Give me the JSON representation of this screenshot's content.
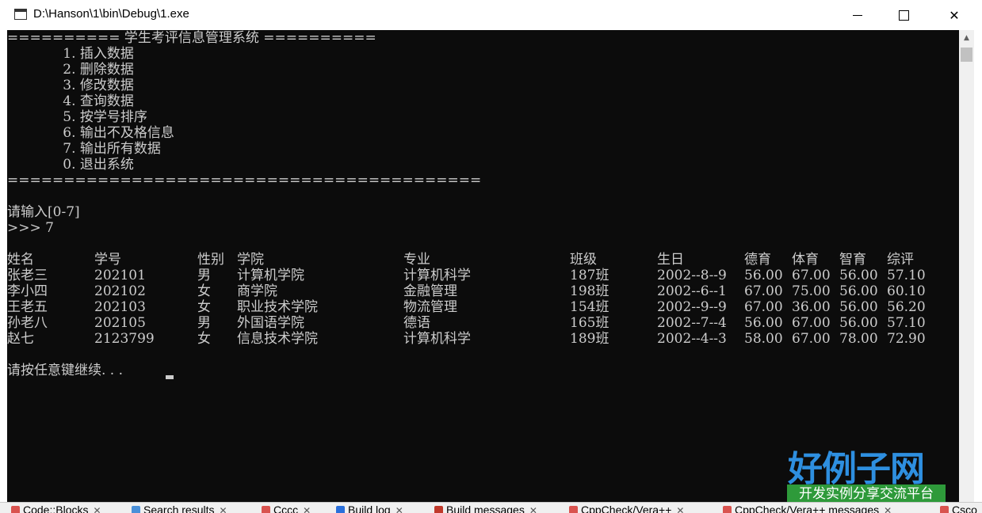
{
  "window": {
    "title": "D:\\Hanson\\1\\bin\\Debug\\1.exe",
    "minimize_label": "—",
    "maximize_label": "☐",
    "close_label": "✕"
  },
  "console": {
    "menu": [
      "========== 学生考评信息管理系统 ==========",
      "             1. 插入数据",
      "             2. 删除数据",
      "             3. 修改数据",
      "             4. 查询数据",
      "             5. 按学号排序",
      "             6. 输出不及格信息",
      "             7. 输出所有数据",
      "             0. 退出系统",
      "=========================================="
    ],
    "prompt": "请输入[0-7]",
    "input_line": ">>> 7",
    "table_headers": [
      "姓名",
      "学号",
      "性别",
      "学院",
      "专业",
      "班级",
      "生日",
      "德育",
      "体育",
      "智育",
      "综评"
    ],
    "table_rows": [
      [
        "张老三",
        "202101",
        "男",
        "计算机学院",
        "计算机科学",
        "187班",
        "2002--8--9",
        "56.00",
        "67.00",
        "56.00",
        "57.10"
      ],
      [
        "李小四",
        "202102",
        "女",
        "商学院",
        "金融管理",
        "198班",
        "2002--6--1",
        "67.00",
        "75.00",
        "56.00",
        "60.10"
      ],
      [
        "王老五",
        "202103",
        "女",
        "职业技术学院",
        "物流管理",
        "154班",
        "2002--9--9",
        "67.00",
        "36.00",
        "56.00",
        "56.20"
      ],
      [
        "孙老八",
        "202105",
        "男",
        "外国语学院",
        "德语",
        "165班",
        "2002--7--4",
        "56.00",
        "67.00",
        "56.00",
        "57.10"
      ],
      [
        "赵七",
        "2123799",
        "女",
        "信息技术学院",
        "计算机科学",
        "189班",
        "2002--4--3",
        "58.00",
        "67.00",
        "78.00",
        "72.90"
      ]
    ],
    "continue_text": "请按任意键继续. . ."
  },
  "taskbar_tabs": [
    {
      "label": "Code::Blocks",
      "icon": "codeblocks-icon",
      "color": "#d9534f"
    },
    {
      "label": "Search results",
      "icon": "search-icon",
      "color": "#4a90d9"
    },
    {
      "label": "Cccc",
      "icon": "cccc-icon",
      "color": "#d9534f"
    },
    {
      "label": "Build log",
      "icon": "build-log-icon",
      "color": "#2a6fdb"
    },
    {
      "label": "Build messages",
      "icon": "build-messages-icon",
      "color": "#c0392b"
    },
    {
      "label": "CppCheck/Vera++",
      "icon": "cppcheck-icon",
      "color": "#d9534f"
    },
    {
      "label": "CppCheck/Vera++ messages",
      "icon": "cppcheck-messages-icon",
      "color": "#d9534f"
    },
    {
      "label": "Csco",
      "icon": "cscope-icon",
      "color": "#d9534f"
    }
  ],
  "watermark": {
    "title": "好例子网",
    "subtitle": "开发实例分享交流平台"
  }
}
